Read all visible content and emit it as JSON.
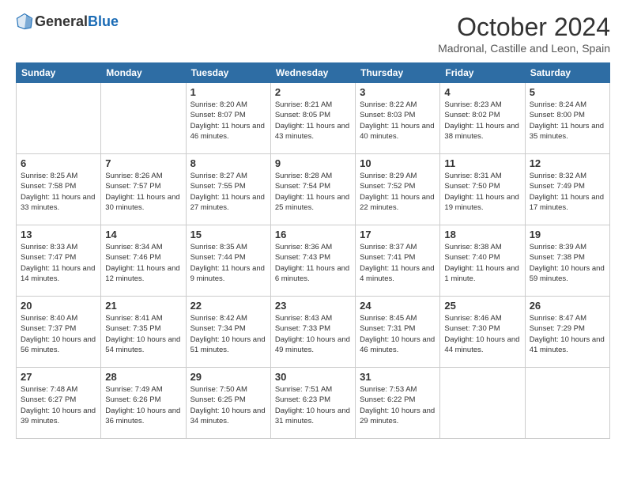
{
  "header": {
    "logo_general": "General",
    "logo_blue": "Blue",
    "month": "October 2024",
    "location": "Madronal, Castille and Leon, Spain"
  },
  "days_of_week": [
    "Sunday",
    "Monday",
    "Tuesday",
    "Wednesday",
    "Thursday",
    "Friday",
    "Saturday"
  ],
  "weeks": [
    [
      {
        "day": "",
        "info": ""
      },
      {
        "day": "",
        "info": ""
      },
      {
        "day": "1",
        "info": "Sunrise: 8:20 AM\nSunset: 8:07 PM\nDaylight: 11 hours and 46 minutes."
      },
      {
        "day": "2",
        "info": "Sunrise: 8:21 AM\nSunset: 8:05 PM\nDaylight: 11 hours and 43 minutes."
      },
      {
        "day": "3",
        "info": "Sunrise: 8:22 AM\nSunset: 8:03 PM\nDaylight: 11 hours and 40 minutes."
      },
      {
        "day": "4",
        "info": "Sunrise: 8:23 AM\nSunset: 8:02 PM\nDaylight: 11 hours and 38 minutes."
      },
      {
        "day": "5",
        "info": "Sunrise: 8:24 AM\nSunset: 8:00 PM\nDaylight: 11 hours and 35 minutes."
      }
    ],
    [
      {
        "day": "6",
        "info": "Sunrise: 8:25 AM\nSunset: 7:58 PM\nDaylight: 11 hours and 33 minutes."
      },
      {
        "day": "7",
        "info": "Sunrise: 8:26 AM\nSunset: 7:57 PM\nDaylight: 11 hours and 30 minutes."
      },
      {
        "day": "8",
        "info": "Sunrise: 8:27 AM\nSunset: 7:55 PM\nDaylight: 11 hours and 27 minutes."
      },
      {
        "day": "9",
        "info": "Sunrise: 8:28 AM\nSunset: 7:54 PM\nDaylight: 11 hours and 25 minutes."
      },
      {
        "day": "10",
        "info": "Sunrise: 8:29 AM\nSunset: 7:52 PM\nDaylight: 11 hours and 22 minutes."
      },
      {
        "day": "11",
        "info": "Sunrise: 8:31 AM\nSunset: 7:50 PM\nDaylight: 11 hours and 19 minutes."
      },
      {
        "day": "12",
        "info": "Sunrise: 8:32 AM\nSunset: 7:49 PM\nDaylight: 11 hours and 17 minutes."
      }
    ],
    [
      {
        "day": "13",
        "info": "Sunrise: 8:33 AM\nSunset: 7:47 PM\nDaylight: 11 hours and 14 minutes."
      },
      {
        "day": "14",
        "info": "Sunrise: 8:34 AM\nSunset: 7:46 PM\nDaylight: 11 hours and 12 minutes."
      },
      {
        "day": "15",
        "info": "Sunrise: 8:35 AM\nSunset: 7:44 PM\nDaylight: 11 hours and 9 minutes."
      },
      {
        "day": "16",
        "info": "Sunrise: 8:36 AM\nSunset: 7:43 PM\nDaylight: 11 hours and 6 minutes."
      },
      {
        "day": "17",
        "info": "Sunrise: 8:37 AM\nSunset: 7:41 PM\nDaylight: 11 hours and 4 minutes."
      },
      {
        "day": "18",
        "info": "Sunrise: 8:38 AM\nSunset: 7:40 PM\nDaylight: 11 hours and 1 minute."
      },
      {
        "day": "19",
        "info": "Sunrise: 8:39 AM\nSunset: 7:38 PM\nDaylight: 10 hours and 59 minutes."
      }
    ],
    [
      {
        "day": "20",
        "info": "Sunrise: 8:40 AM\nSunset: 7:37 PM\nDaylight: 10 hours and 56 minutes."
      },
      {
        "day": "21",
        "info": "Sunrise: 8:41 AM\nSunset: 7:35 PM\nDaylight: 10 hours and 54 minutes."
      },
      {
        "day": "22",
        "info": "Sunrise: 8:42 AM\nSunset: 7:34 PM\nDaylight: 10 hours and 51 minutes."
      },
      {
        "day": "23",
        "info": "Sunrise: 8:43 AM\nSunset: 7:33 PM\nDaylight: 10 hours and 49 minutes."
      },
      {
        "day": "24",
        "info": "Sunrise: 8:45 AM\nSunset: 7:31 PM\nDaylight: 10 hours and 46 minutes."
      },
      {
        "day": "25",
        "info": "Sunrise: 8:46 AM\nSunset: 7:30 PM\nDaylight: 10 hours and 44 minutes."
      },
      {
        "day": "26",
        "info": "Sunrise: 8:47 AM\nSunset: 7:29 PM\nDaylight: 10 hours and 41 minutes."
      }
    ],
    [
      {
        "day": "27",
        "info": "Sunrise: 7:48 AM\nSunset: 6:27 PM\nDaylight: 10 hours and 39 minutes."
      },
      {
        "day": "28",
        "info": "Sunrise: 7:49 AM\nSunset: 6:26 PM\nDaylight: 10 hours and 36 minutes."
      },
      {
        "day": "29",
        "info": "Sunrise: 7:50 AM\nSunset: 6:25 PM\nDaylight: 10 hours and 34 minutes."
      },
      {
        "day": "30",
        "info": "Sunrise: 7:51 AM\nSunset: 6:23 PM\nDaylight: 10 hours and 31 minutes."
      },
      {
        "day": "31",
        "info": "Sunrise: 7:53 AM\nSunset: 6:22 PM\nDaylight: 10 hours and 29 minutes."
      },
      {
        "day": "",
        "info": ""
      },
      {
        "day": "",
        "info": ""
      }
    ]
  ]
}
